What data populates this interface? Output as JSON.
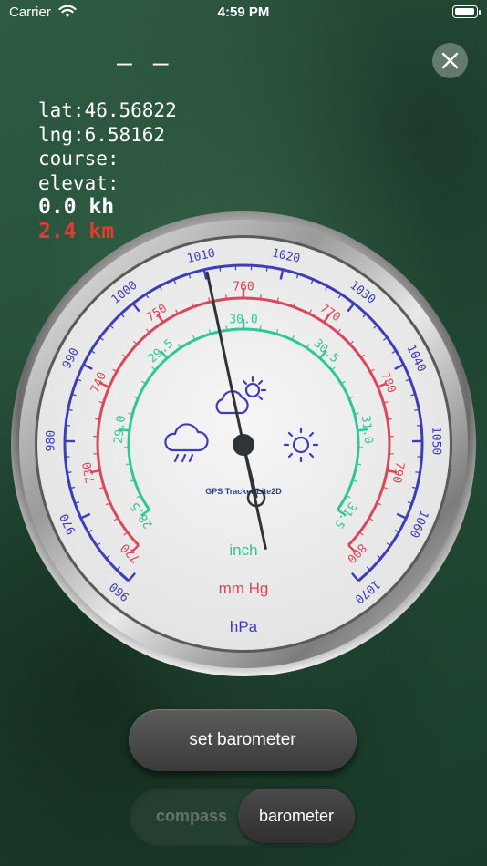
{
  "status_bar": {
    "carrier": "Carrier",
    "time": "4:59 PM",
    "battery_level": 0.95
  },
  "header": {
    "title": "— —"
  },
  "info": {
    "lat": "lat:46.56822",
    "lng": "lng:6.58162",
    "course": "course:",
    "elevation": "elevat:",
    "speed": "0.0 kh",
    "distance": "2.4 km"
  },
  "gauge": {
    "brand": "GPS Tracker Lite2D",
    "needle_hpa": 1010.3,
    "scales": {
      "hpa": {
        "unit": "hPa",
        "color": "#3d3db8",
        "labels": [
          "960",
          "970",
          "980",
          "990",
          "1000",
          "1010",
          "1020",
          "1030",
          "1040",
          "1050",
          "1060",
          "1070"
        ]
      },
      "mmhg": {
        "unit": "mm Hg",
        "color": "#d9485a",
        "labels": [
          "720",
          "730",
          "740",
          "750",
          "760",
          "770",
          "780",
          "790",
          "800"
        ]
      },
      "inch": {
        "unit": "inch",
        "color": "#2fc79a",
        "labels": [
          "28.5",
          "29.0",
          "29.5",
          "30.0",
          "30.5",
          "31.0",
          "31.5"
        ]
      }
    },
    "weather_icons": [
      "rain-cloud-icon",
      "partly-cloudy-icon",
      "sun-icon"
    ]
  },
  "controls": {
    "set_barometer": "set barometer",
    "mode_compass": "compass",
    "mode_barometer": "barometer",
    "selected_mode": "barometer"
  }
}
